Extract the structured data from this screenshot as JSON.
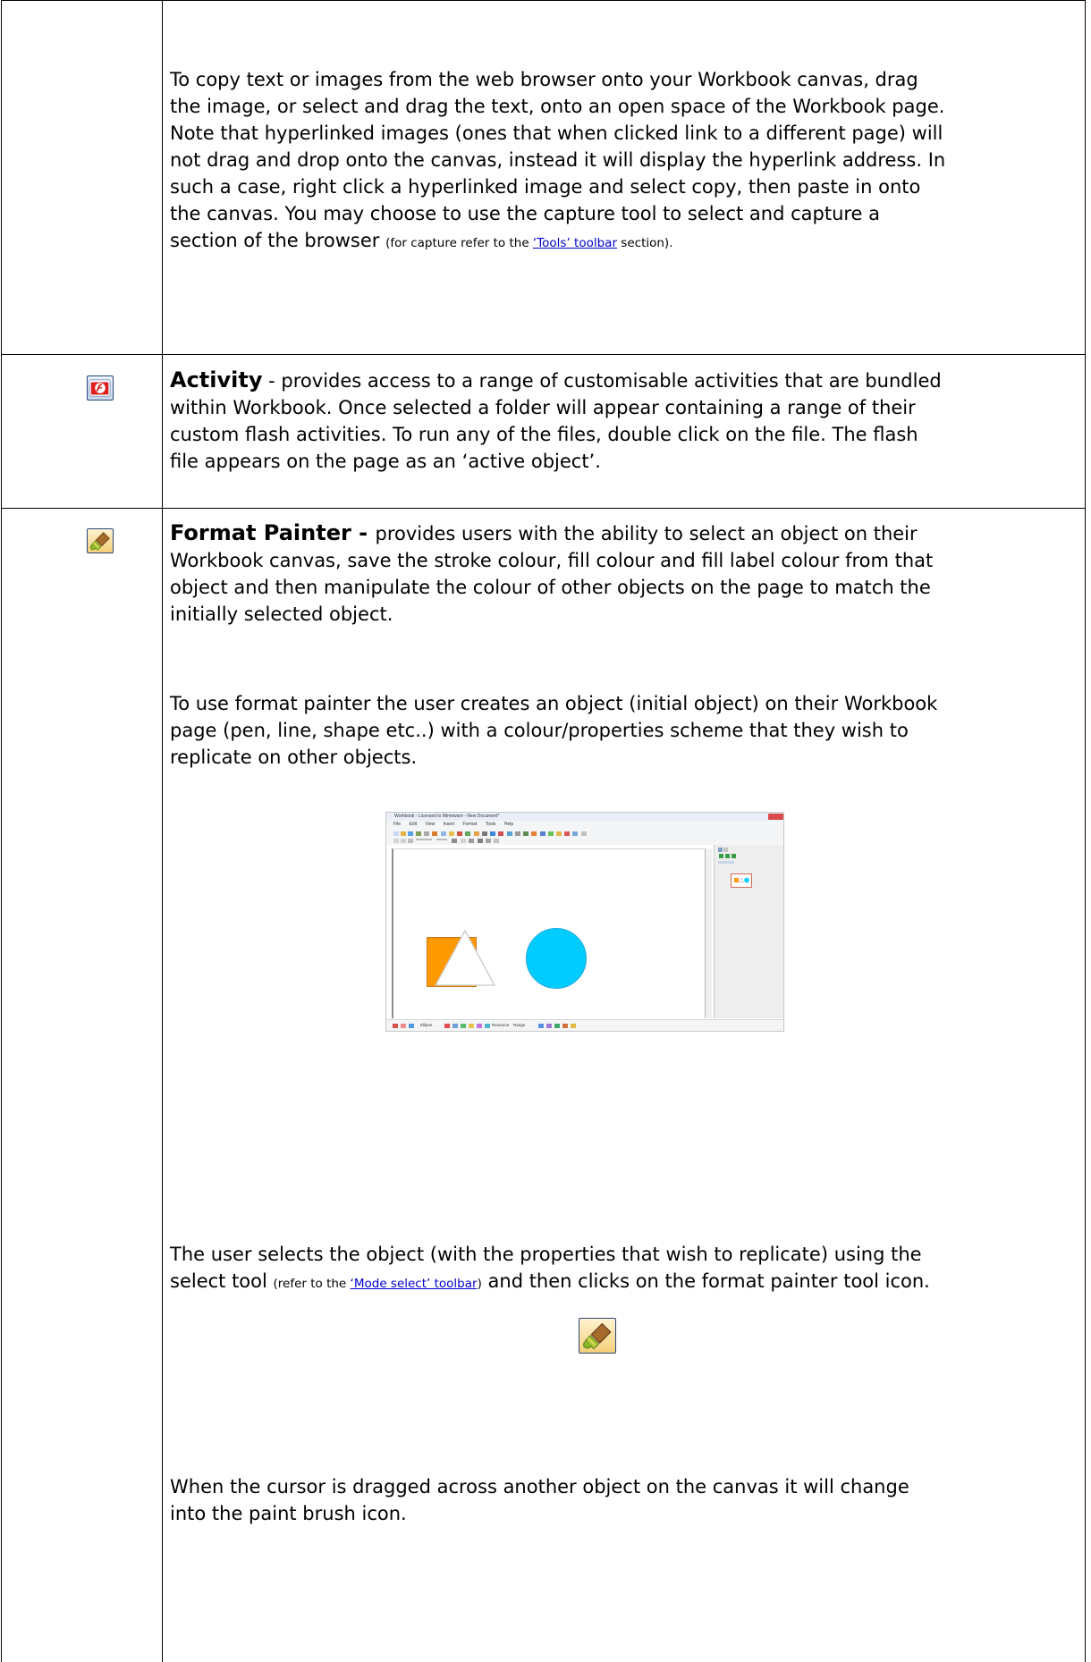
{
  "document": {
    "intro_paragraph": "To copy text or images from the web browser onto your Workbook canvas, drag the image, or select and drag the text, onto an open space of the Workbook page.  Note that hyperlinked images (ones that when clicked link to a different page) will not drag and drop onto the canvas, instead it will display the hyperlink address.  In such a case, right click a hyperlinked image and select copy, then paste in onto the canvas.  You may choose to use the capture tool to select and capture a section of the browser",
    "intro_note_prefix": "(for capture refer to the ",
    "intro_note_link": "‘Tools’ toolbar",
    "intro_note_suffix": " section)."
  },
  "rows": {
    "activity": {
      "title": "Activity",
      "text": " - provides access to a range of customisable activities that are bundled within Workbook.  Once selected a folder will appear containing a range of their custom flash activities.  To run any of the files, double click on the file.  The flash file appears on the page as an ‘active object’."
    },
    "format_painter": {
      "title": "Format Painter - ",
      "description": "provides users with the ability to select an object on their Workbook canvas, save the stroke colour, fill colour and fill label colour from that object and then manipulate the colour of other objects on the page to match the initially selected object.",
      "usage_paragraph": "To use format painter the user creates an object (initial object) on their Workbook page (pen, line, shape etc..) with a colour/properties scheme that they wish to replicate on other objects.",
      "selection_prefix": "The user selects the object (with the properties that wish to replicate) using the select tool ",
      "selection_note_prefix": "(refer to the ",
      "selection_link": "‘Mode select’ toolbar",
      "selection_note_suffix": ")",
      "selection_suffix": " and then clicks on the format painter tool icon.",
      "cursor_paragraph": "When the cursor is dragged across another object on the canvas it will change into the paint brush icon."
    }
  },
  "screenshot": {
    "title": "Workbook - Licensed to Mimeware - New Document*",
    "menu_items": [
      "File",
      "Edit",
      "View",
      "Insert",
      "Format",
      "Tools",
      "Help"
    ],
    "status_items": [
      "Ellipse",
      "Resource",
      "Range"
    ]
  },
  "icons": {
    "activity": "activity-flash-folder-icon",
    "format_painter": "format-painter-brush-icon",
    "inline_format_painter": "format-painter-brush-icon"
  },
  "colors": {
    "border": "#000000",
    "link": "#0000cc",
    "square": "#ff9900",
    "circle": "#00ccff"
  }
}
